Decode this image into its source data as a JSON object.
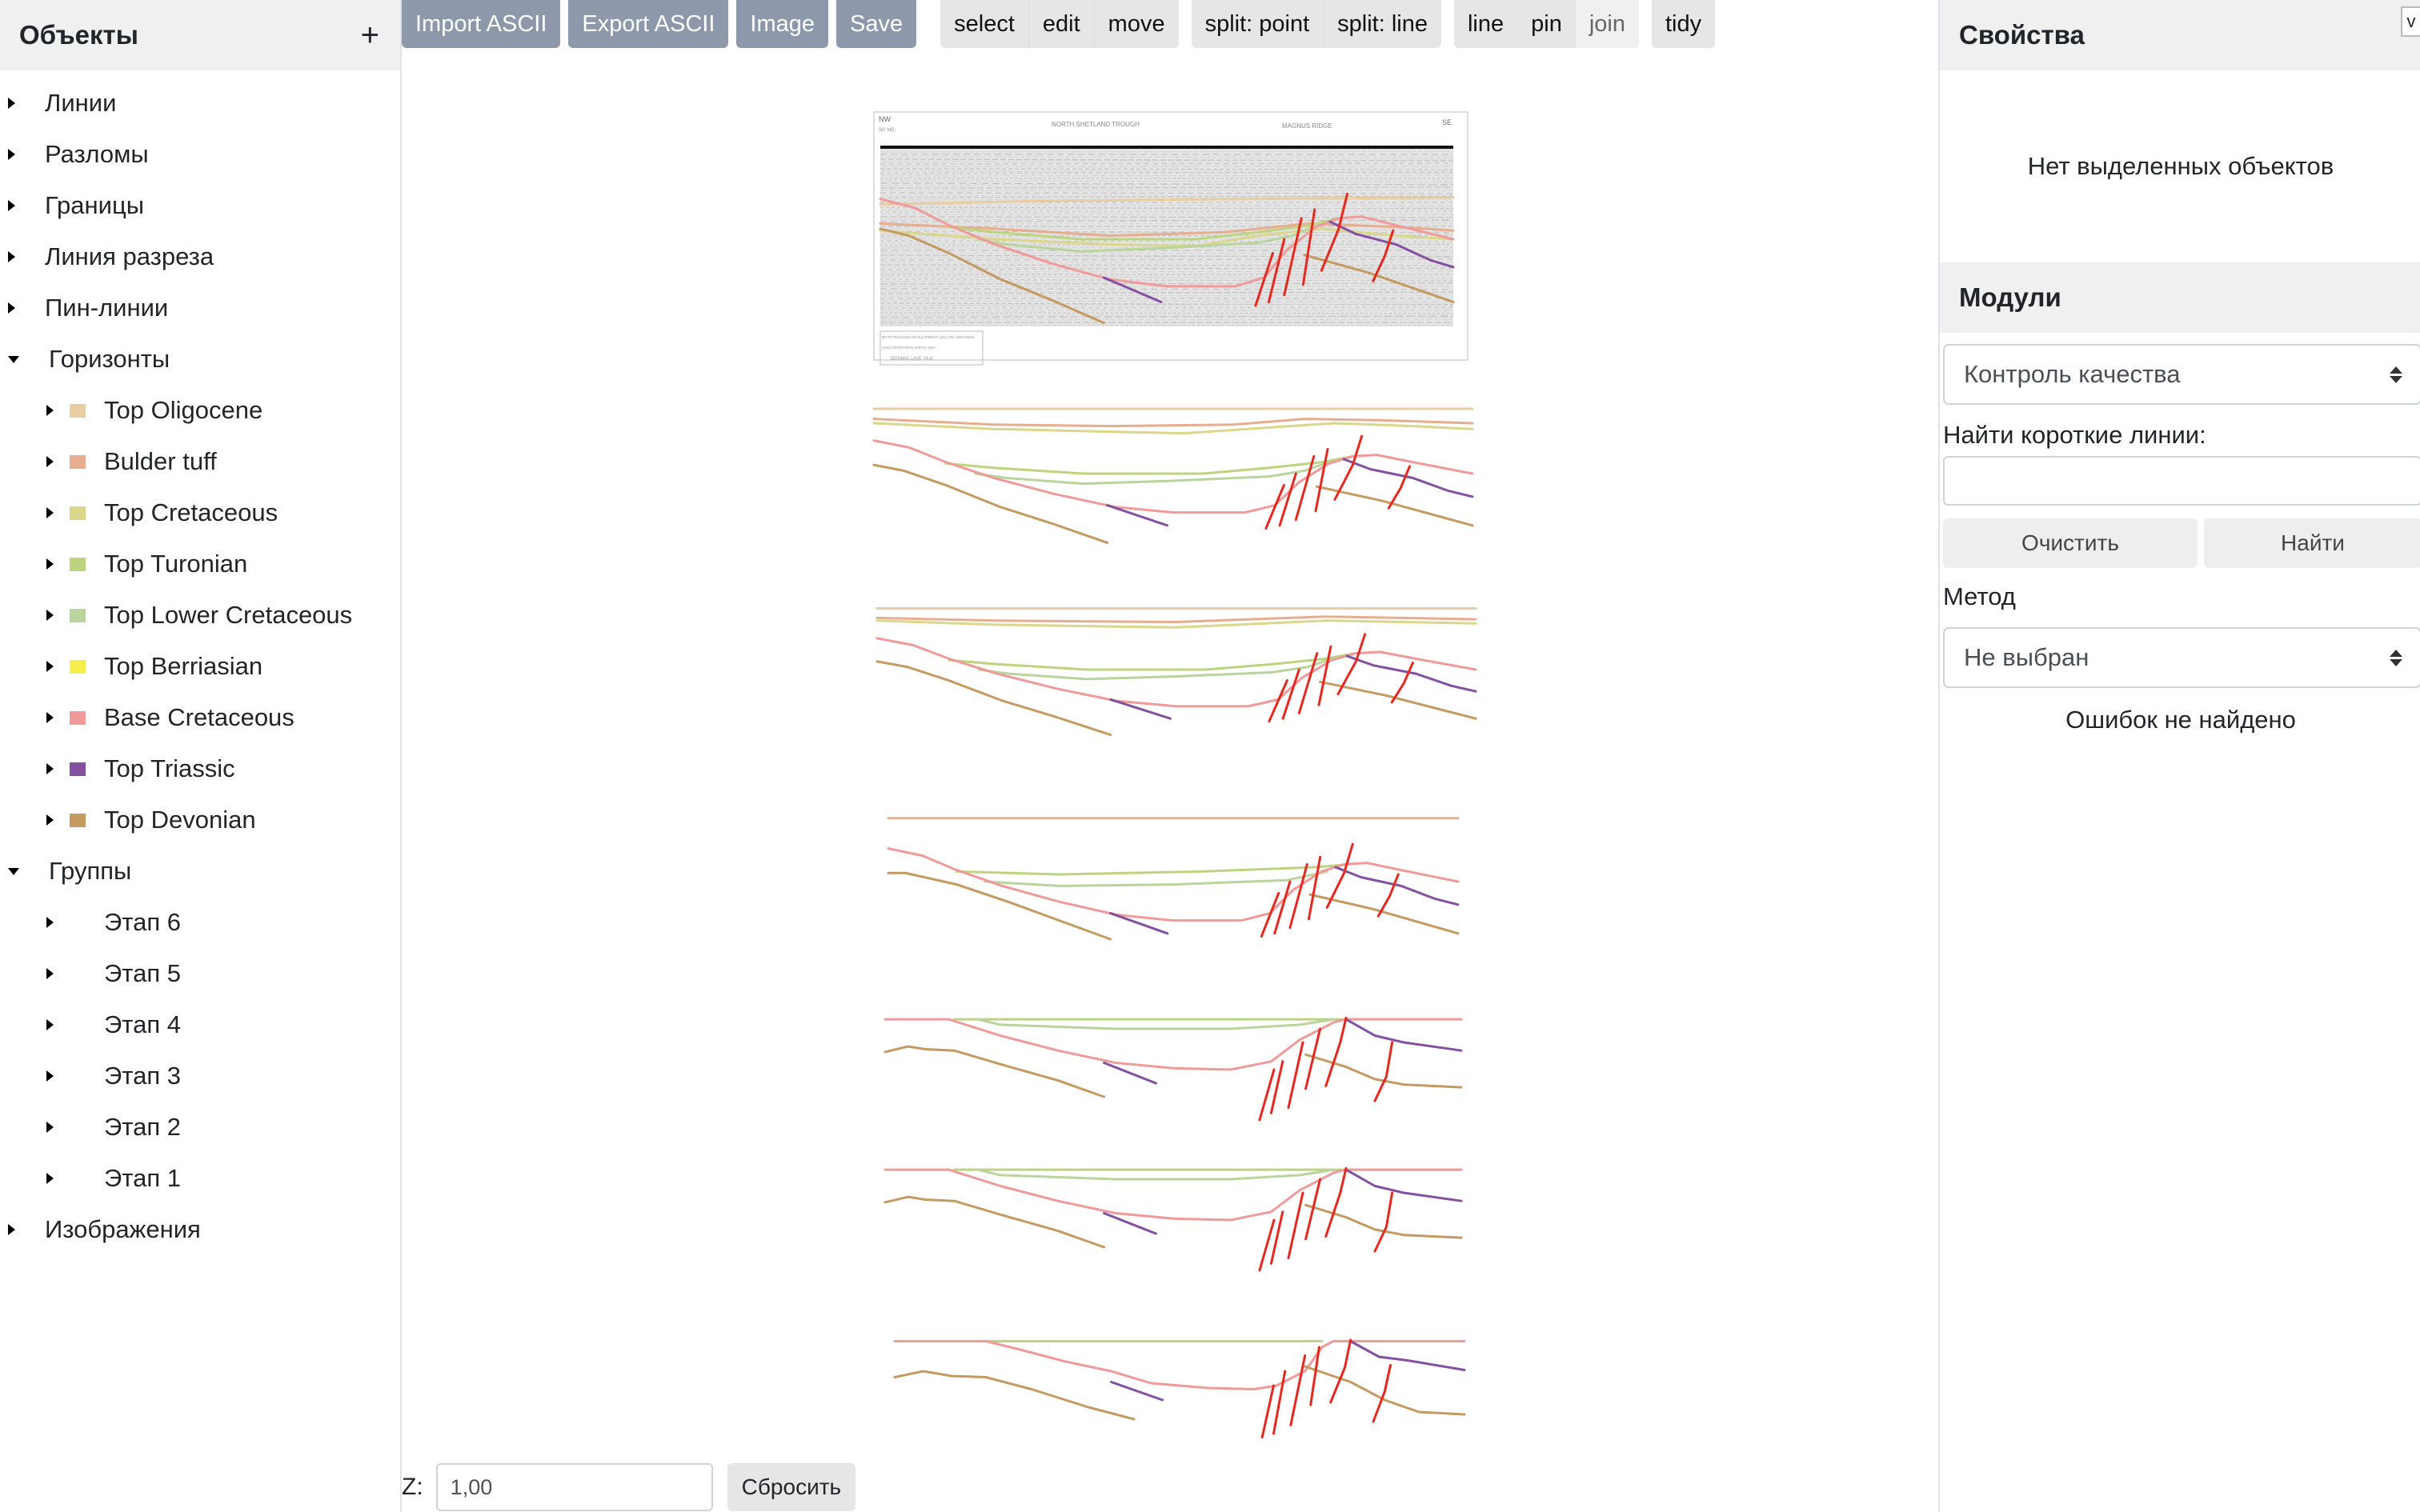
{
  "left_panel": {
    "title": "Объекты",
    "add_label": "+",
    "tree": [
      {
        "label": "Линии",
        "expanded": false
      },
      {
        "label": "Разломы",
        "expanded": false
      },
      {
        "label": "Границы",
        "expanded": false
      },
      {
        "label": "Линия разреза",
        "expanded": false
      },
      {
        "label": "Пин-линии",
        "expanded": false
      },
      {
        "label": "Горизонты",
        "expanded": true
      },
      {
        "label": "Группы",
        "expanded": true
      },
      {
        "label": "Изображения",
        "expanded": false
      }
    ],
    "horizons": [
      {
        "label": "Top Oligocene",
        "color": "#e8cda0"
      },
      {
        "label": "Bulder tuff",
        "color": "#e8ad8e"
      },
      {
        "label": "Top Cretaceous",
        "color": "#dad68a"
      },
      {
        "label": "Top Turonian",
        "color": "#bdd47e"
      },
      {
        "label": "Top Lower Cretaceous",
        "color": "#bad49d"
      },
      {
        "label": "Top Berriasian",
        "color": "#f6ee4e"
      },
      {
        "label": "Base Cretaceous",
        "color": "#f09a9a"
      },
      {
        "label": "Top Triassic",
        "color": "#8450a0"
      },
      {
        "label": "Top Devonian",
        "color": "#c49a60"
      }
    ],
    "groups": [
      {
        "label": "Этап 6"
      },
      {
        "label": "Этап 5"
      },
      {
        "label": "Этап 4"
      },
      {
        "label": "Этап 3"
      },
      {
        "label": "Этап 2"
      },
      {
        "label": "Этап 1"
      }
    ]
  },
  "toolbar": {
    "file_buttons": [
      "Import ASCII",
      "Export ASCII",
      "Image",
      "Save"
    ],
    "mode_group": [
      "select",
      "edit",
      "move"
    ],
    "split_group": [
      "split: point",
      "split: line"
    ],
    "draw_group": [
      "line",
      "pin",
      "join"
    ],
    "tidy_label": "tidy"
  },
  "canvas": {
    "seismic_image": {
      "left_label": "NW",
      "right_label": "SE",
      "sp_label": "SP. NO.",
      "title_left": "NORTH SHETLAND TROUGH",
      "title_right": "MAGNUS RIDGE",
      "footer_company": "BP PETROLEUM DEVELOPMENT (UK) LTD ABERDEEN",
      "footer_area": "UKCS NORTHERN NORTH SEA",
      "footer_line": "SEISMIC LINE 74-6"
    },
    "fault_color": "#e8281e"
  },
  "zoom_bar": {
    "label": "Z:",
    "value": "1,00",
    "reset_label": "Сбросить"
  },
  "right_panel": {
    "toggle_label": "v",
    "properties_title": "Свойства",
    "no_selection": "Нет выделенных объектов",
    "modules_title": "Модули",
    "module_selected": "Контроль качества",
    "short_lines_label": "Найти короткие линии:",
    "short_lines_value": "",
    "clear_label": "Очистить",
    "find_label": "Найти",
    "method_label": "Метод",
    "method_selected": "Не выбран",
    "status": "Ошибок не найдено"
  }
}
